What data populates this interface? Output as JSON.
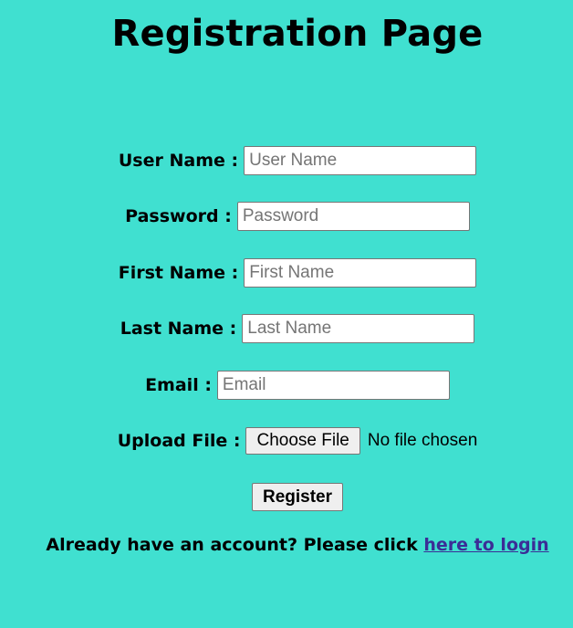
{
  "page": {
    "title": "Registration Page"
  },
  "form": {
    "username": {
      "label": "User Name :",
      "placeholder": "User Name",
      "value": ""
    },
    "password": {
      "label": "Password :",
      "placeholder": "Password",
      "value": ""
    },
    "firstname": {
      "label": "First Name :",
      "placeholder": "First Name",
      "value": ""
    },
    "lastname": {
      "label": "Last Name :",
      "placeholder": "Last Name",
      "value": ""
    },
    "email": {
      "label": "Email :",
      "placeholder": "Email",
      "value": ""
    },
    "file": {
      "label": "Upload File :",
      "button_label": "Choose File",
      "status": "No file chosen"
    },
    "register_label": "Register"
  },
  "footer": {
    "prompt": "Already have an account? Please click ",
    "link_text": "here to login"
  }
}
